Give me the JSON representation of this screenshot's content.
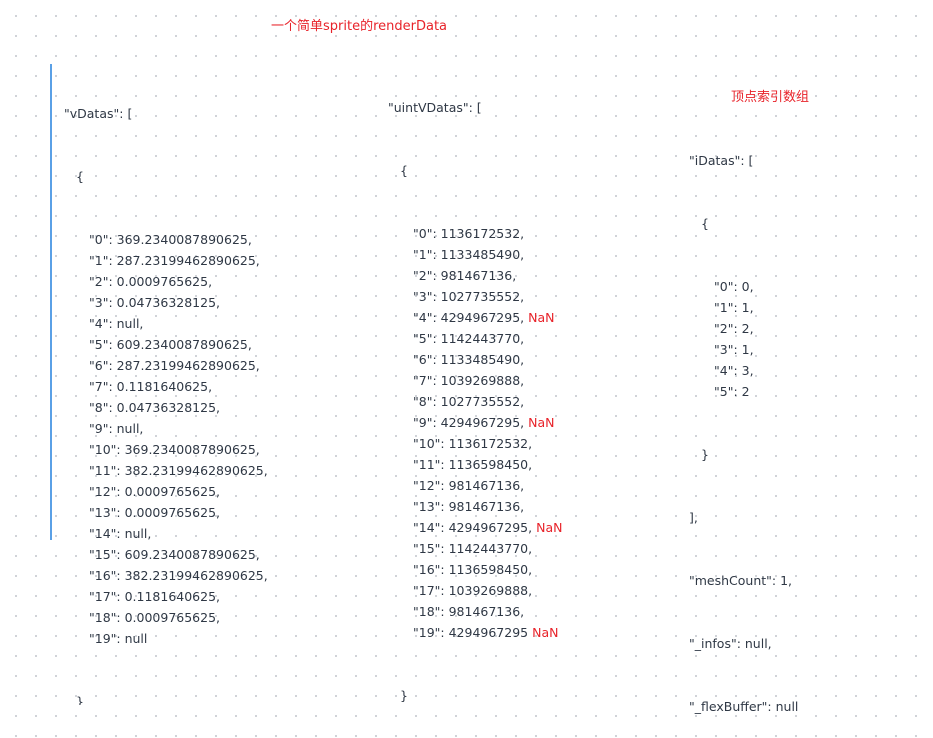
{
  "labels": {
    "title": "一个简单sprite的renderData",
    "index_note": "顶点索引数组",
    "nan": "NaN"
  },
  "vDatas": {
    "open": "\"vDatas\": [",
    "brace_open": "{",
    "lines": [
      "\"0\": 369.2340087890625,",
      "\"1\": 287.23199462890625,",
      "\"2\": 0.0009765625,",
      "\"3\": 0.04736328125,",
      "\"4\": null,",
      "\"5\": 609.2340087890625,",
      "\"6\": 287.23199462890625,",
      "\"7\": 0.1181640625,",
      "\"8\": 0.04736328125,",
      "\"9\": null,",
      "\"10\": 369.2340087890625,",
      "\"11\": 382.23199462890625,",
      "\"12\": 0.0009765625,",
      "\"13\": 0.0009765625,",
      "\"14\": null,",
      "\"15\": 609.2340087890625,",
      "\"16\": 382.23199462890625,",
      "\"17\": 0.1181640625,",
      "\"18\": 0.0009765625,",
      "\"19\": null"
    ],
    "brace_close": "}"
  },
  "uintVDatas": {
    "open": "\"uintVDatas\": [",
    "brace_open": "{",
    "lines": [
      {
        "text": "\"0\": 1136172532,",
        "nan": false
      },
      {
        "text": "\"1\": 1133485490,",
        "nan": false
      },
      {
        "text": "\"2\": 981467136,",
        "nan": false
      },
      {
        "text": "\"3\": 1027735552,",
        "nan": false
      },
      {
        "text": "\"4\": 4294967295,",
        "nan": true
      },
      {
        "text": "\"5\": 1142443770,",
        "nan": false
      },
      {
        "text": "\"6\": 1133485490,",
        "nan": false
      },
      {
        "text": "\"7\": 1039269888,",
        "nan": false
      },
      {
        "text": "\"8\": 1027735552,",
        "nan": false
      },
      {
        "text": "\"9\": 4294967295,",
        "nan": true
      },
      {
        "text": "\"10\": 1136172532,",
        "nan": false
      },
      {
        "text": "\"11\": 1136598450,",
        "nan": false
      },
      {
        "text": "\"12\": 981467136,",
        "nan": false
      },
      {
        "text": "\"13\": 981467136,",
        "nan": false
      },
      {
        "text": "\"14\": 4294967295,",
        "nan": true
      },
      {
        "text": "\"15\": 1142443770,",
        "nan": false
      },
      {
        "text": "\"16\": 1136598450,",
        "nan": false
      },
      {
        "text": "\"17\": 1039269888,",
        "nan": false
      },
      {
        "text": "\"18\": 981467136,",
        "nan": false
      },
      {
        "text": "\"19\": 4294967295",
        "nan": true
      }
    ],
    "brace_close": "}"
  },
  "iDatas": {
    "open": "\"iDatas\": [",
    "brace_open": "{",
    "lines": [
      "\"0\": 0,",
      "\"1\": 1,",
      "\"2\": 2,",
      "\"3\": 1,",
      "\"4\": 3,",
      "\"5\": 2"
    ],
    "brace_close": "}",
    "array_close": "],",
    "meshCount": "\"meshCount\": 1,",
    "infos": "\"_infos\": null,",
    "flexBuffer": "\"_flexBuffer\": null"
  }
}
